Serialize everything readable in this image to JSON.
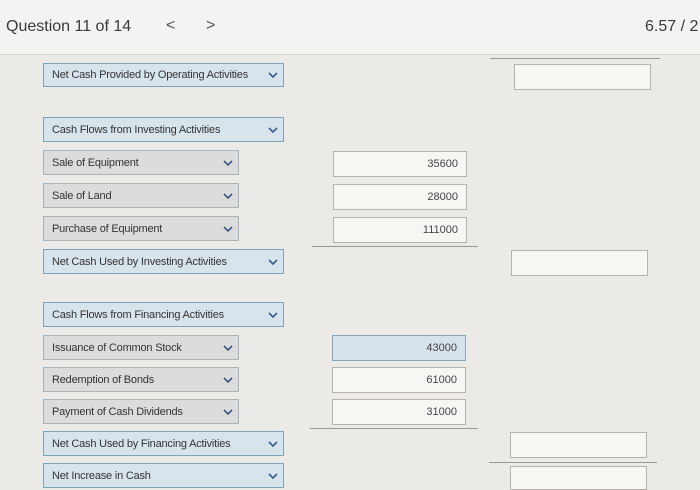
{
  "header": {
    "question": "Question 11 of 14",
    "prev": "<",
    "next": ">",
    "score": "6.57 / 2"
  },
  "rows": {
    "operating_net": {
      "label": "Net Cash Provided by Operating Activities",
      "amount": ""
    },
    "investing_heading": {
      "label": "Cash Flows from Investing Activities"
    },
    "sale_equipment": {
      "label": "Sale of Equipment",
      "amount": "35600"
    },
    "sale_land": {
      "label": "Sale of Land",
      "amount": "28000"
    },
    "purchase_equipment": {
      "label": "Purchase of Equipment",
      "amount": "111000"
    },
    "investing_net": {
      "label": "Net Cash Used by Investing Activities",
      "amount": ""
    },
    "financing_heading": {
      "label": "Cash Flows from Financing Activities"
    },
    "issuance_stock": {
      "label": "Issuance of Common Stock",
      "amount": "43000"
    },
    "redemption_bonds": {
      "label": "Redemption of Bonds",
      "amount": "61000"
    },
    "cash_dividends": {
      "label": "Payment of Cash Dividends",
      "amount": "31000"
    },
    "financing_net": {
      "label": "Net Cash Used by Financing Activities",
      "amount": ""
    },
    "net_increase": {
      "label": "Net Increase in Cash",
      "amount": ""
    }
  },
  "icons": {
    "dropdown": "chevron-down-icon"
  },
  "colors": {
    "select_bg": "#d8e4ec",
    "select_border": "#7ea2b8",
    "page_bg": "#eceae6"
  }
}
